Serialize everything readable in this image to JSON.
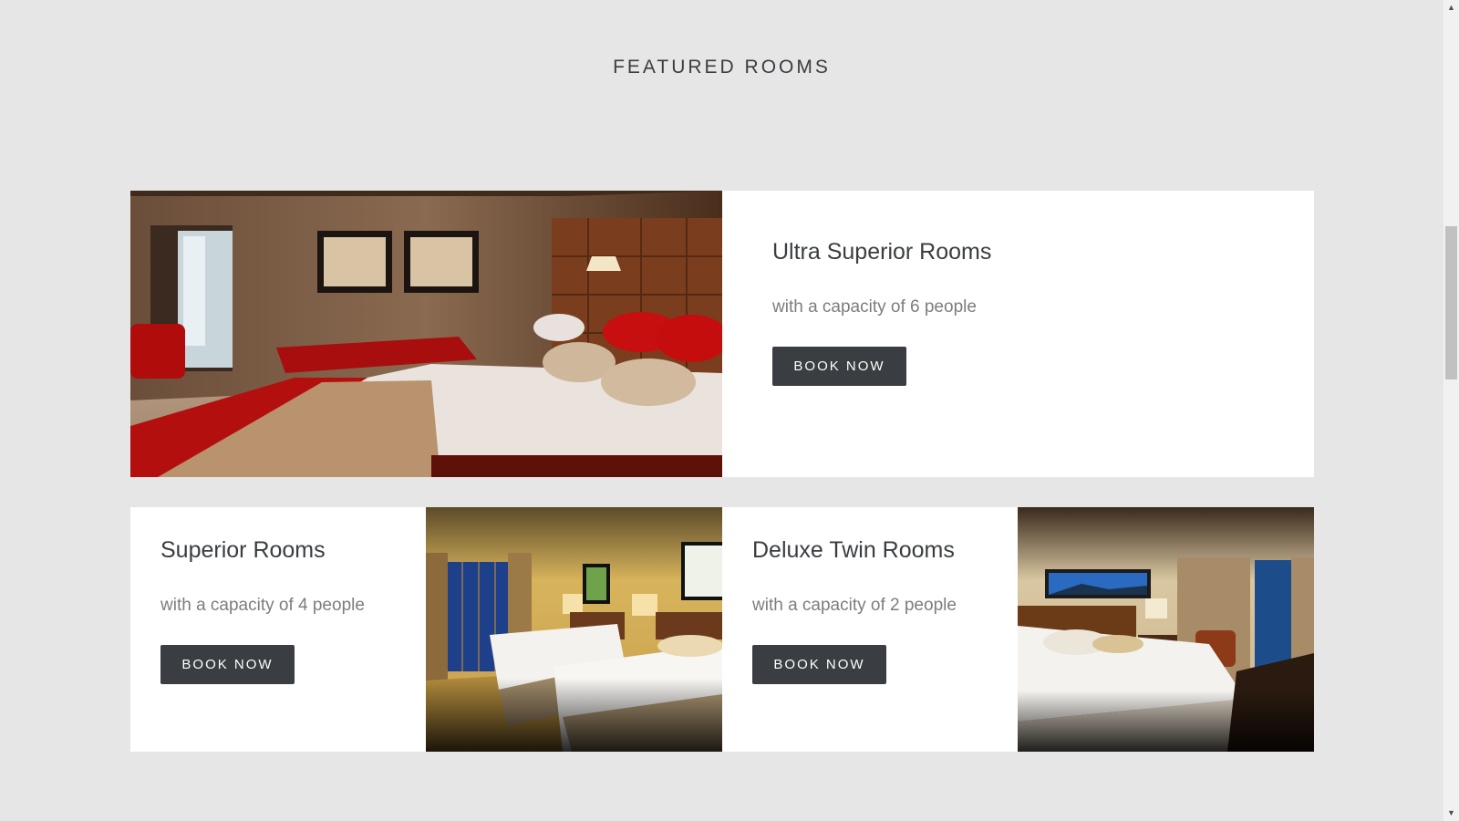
{
  "section": {
    "title": "FEATURED ROOMS"
  },
  "rooms": [
    {
      "title": "Ultra Superior Rooms",
      "capacity": "with a capacity of 6 people",
      "button": "BOOK NOW"
    },
    {
      "title": "Superior Rooms",
      "capacity": "with a capacity of 4 people",
      "button": "BOOK NOW"
    },
    {
      "title": "Deluxe Twin Rooms",
      "capacity": "with a capacity of 2 people",
      "button": "BOOK NOW"
    }
  ],
  "photos": [
    {
      "name": "ultra-superior-room-photo",
      "scene": "room with red bedding and leather headboard"
    },
    {
      "name": "superior-room-photo",
      "scene": "twin beds with city window"
    },
    {
      "name": "deluxe-twin-room-photo",
      "scene": "king bed with panorama painting"
    }
  ],
  "scrollbar": {
    "up_icon": "scroll-up-icon",
    "down_icon": "scroll-down-icon"
  }
}
